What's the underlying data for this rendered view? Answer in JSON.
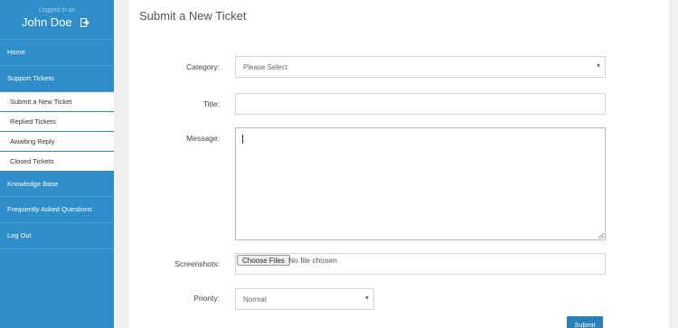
{
  "user": {
    "logged_in_label": "Logged in as",
    "name": "John Doe"
  },
  "sidebar": {
    "items": [
      {
        "label": "Home"
      },
      {
        "label": "Support Tickets"
      }
    ],
    "sub_items": [
      {
        "label": "Submit a New Ticket"
      },
      {
        "label": "Replied Tickets"
      },
      {
        "label": "Awaiting Reply"
      },
      {
        "label": "Closed Tickets"
      }
    ],
    "items_after": [
      {
        "label": "Knowledge Base"
      },
      {
        "label": "Frequently Asked Questions"
      },
      {
        "label": "Log Out"
      }
    ]
  },
  "form": {
    "title": "Submit a New Ticket",
    "category": {
      "label": "Category:",
      "value": "Please Select"
    },
    "title_field": {
      "label": "Title:",
      "value": ""
    },
    "message": {
      "label": "Message:",
      "value": ""
    },
    "screenshots": {
      "label": "Screenshots:",
      "button": "Choose Files",
      "status": "No file chosen"
    },
    "priority": {
      "label": "Priority:",
      "value": "Normal"
    },
    "submit_label": "Submit"
  },
  "colors": {
    "sidebar": "#2f8ec9",
    "accent": "#2a7fb6",
    "background": "#f0f0f0"
  }
}
